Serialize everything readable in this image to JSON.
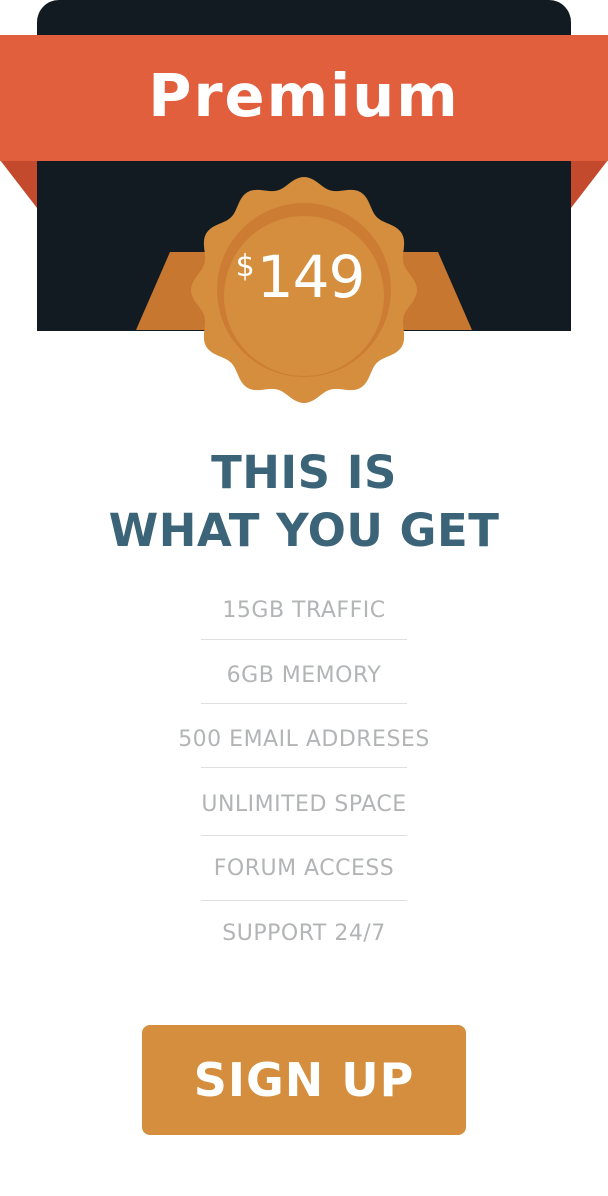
{
  "plan": {
    "name": "Premium",
    "price_currency": "$",
    "price_amount": "149"
  },
  "headline": {
    "line1": "THIS IS",
    "line2": "WHAT YOU GET"
  },
  "features": [
    "15GB TRAFFIC",
    "6GB MEMORY",
    "500 EMAIL ADDRESES",
    "UNLIMITED SPACE",
    "FORUM ACCESS",
    "SUPPORT 24/7"
  ],
  "cta": {
    "label": "SIGN UP"
  },
  "colors": {
    "card_dark": "#131b22",
    "ribbon": "#e25f3d",
    "ribbon_fold": "#c44a2d",
    "medal": "#d48e3d",
    "medal_ribbon": "#c7772f",
    "headline": "#3b6479",
    "feature_text": "#b2b4b6",
    "button": "#d48e3d"
  }
}
